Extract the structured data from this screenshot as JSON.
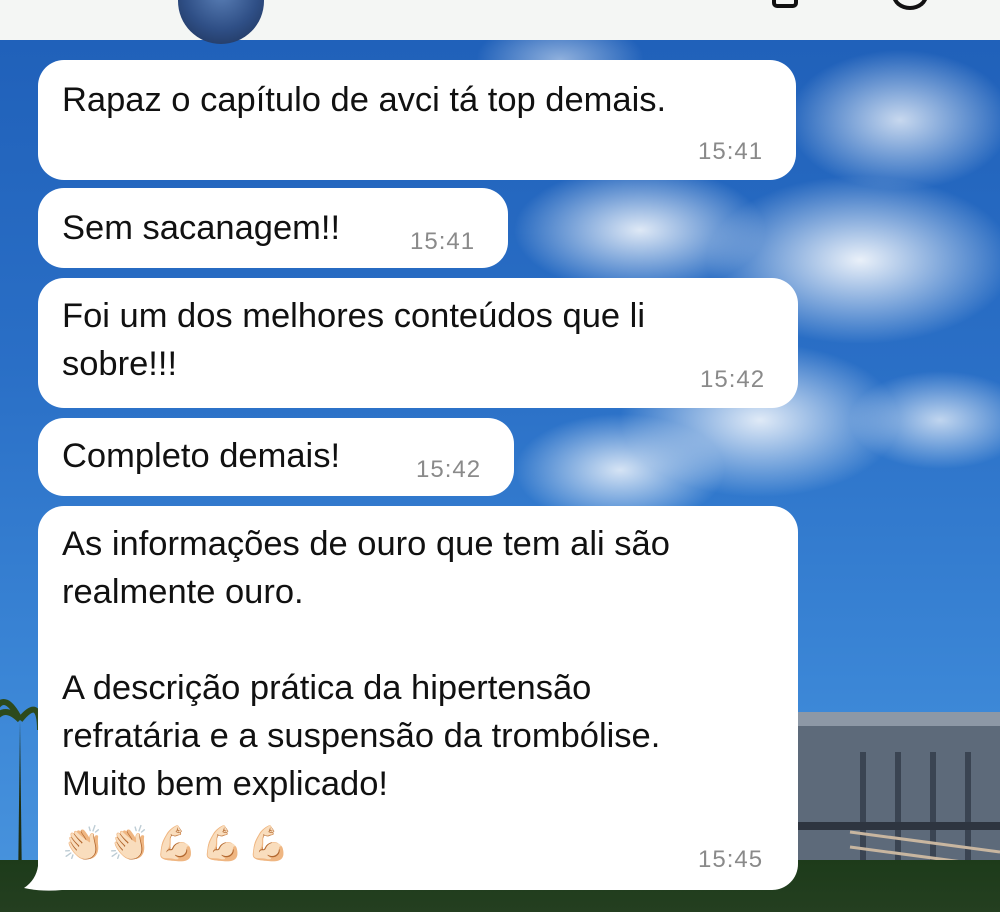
{
  "messages": [
    {
      "text": "Rapaz o capítulo de avci tá top demais.",
      "time": "15:41"
    },
    {
      "text": "Sem sacanagem!!",
      "time": "15:41"
    },
    {
      "text": "Foi um dos melhores conteúdos que li\nsobre!!!",
      "time": "15:42"
    },
    {
      "text": "Completo demais!",
      "time": "15:42"
    },
    {
      "text": "As informações de ouro que tem ali são\nrealmente ouro.\n\nA descrição prática da hipertensão\nrefratária e a suspensão da trombólise.\nMuito bem explicado!",
      "emoji": "👏🏻👏🏻💪🏻💪🏻💪🏻",
      "time": "15:45"
    }
  ],
  "colors": {
    "bubble": "#ffffff",
    "timestamp": "#8a8a8a",
    "sky": "#2a6fc6"
  }
}
